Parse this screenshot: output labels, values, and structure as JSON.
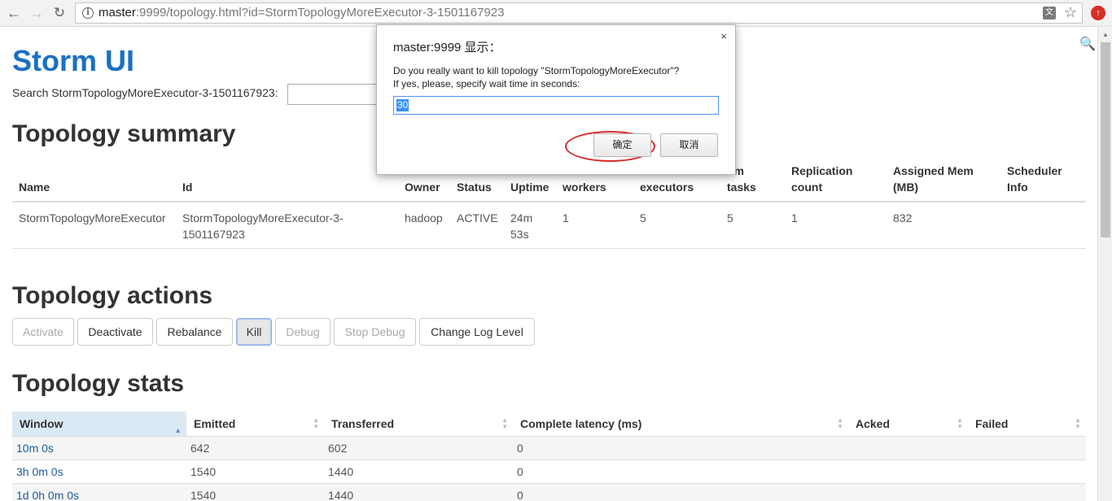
{
  "browser": {
    "url_host": "master",
    "url_rest": ":9999/topology.html?id=StormTopologyMoreExecutor-3-1501167923"
  },
  "page": {
    "brand": "Storm UI",
    "search_label": "Search StormTopologyMoreExecutor-3-1501167923:"
  },
  "summary": {
    "heading": "Topology summary",
    "columns": {
      "name": "Name",
      "id": "Id",
      "owner": "Owner",
      "status": "Status",
      "uptime": "Uptime",
      "workers": "workers",
      "executors": "executors",
      "tasks_1": "um",
      "tasks_2": "tasks",
      "replication_1": "Replication",
      "replication_2": "count",
      "mem_1": "Assigned Mem",
      "mem_2": "(MB)",
      "scheduler_1": "Scheduler",
      "scheduler_2": "Info"
    },
    "row": {
      "name": "StormTopologyMoreExecutor",
      "id_1": "StormTopologyMoreExecutor-3-",
      "id_2": "1501167923",
      "owner": "hadoop",
      "status": "ACTIVE",
      "uptime_1": "24m",
      "uptime_2": "53s",
      "workers": "1",
      "executors": "5",
      "tasks": "5",
      "replication": "1",
      "mem": "832",
      "scheduler": ""
    }
  },
  "actions": {
    "heading": "Topology actions",
    "activate": "Activate",
    "deactivate": "Deactivate",
    "rebalance": "Rebalance",
    "kill": "Kill",
    "debug": "Debug",
    "stop_debug": "Stop Debug",
    "change_log_level": "Change Log Level"
  },
  "stats": {
    "heading": "Topology stats",
    "columns": {
      "window": "Window",
      "emitted": "Emitted",
      "transferred": "Transferred",
      "latency": "Complete latency (ms)",
      "acked": "Acked",
      "failed": "Failed"
    },
    "rows": [
      {
        "window": "10m 0s",
        "emitted": "642",
        "transferred": "602",
        "latency": "0",
        "acked": "",
        "failed": ""
      },
      {
        "window": "3h 0m 0s",
        "emitted": "1540",
        "transferred": "1440",
        "latency": "0",
        "acked": "",
        "failed": ""
      },
      {
        "window": "1d 0h 0m 0s",
        "emitted": "1540",
        "transferred": "1440",
        "latency": "0",
        "acked": "",
        "failed": ""
      }
    ]
  },
  "dialog": {
    "title": "master:9999 显示：",
    "message_1": "Do you really want to kill topology \"StormTopologyMoreExecutor\"?",
    "message_2": "If yes, please, specify wait time in seconds:",
    "input_value": "30",
    "ok_label": "确定",
    "cancel_label": "取消",
    "close_glyph": "×"
  },
  "colors": {
    "brand": "#1a6fc4",
    "link": "#1f5c99",
    "highlight_ring": "#d42a2a",
    "sorted_header": "#dbe9f4"
  },
  "icons": {
    "back": "back-arrow-icon",
    "forward": "forward-arrow-icon",
    "reload": "reload-icon",
    "info": "info-icon",
    "translate": "translate-icon",
    "bookmark": "star-icon",
    "extension": "extension-icon",
    "search": "search-icon"
  }
}
